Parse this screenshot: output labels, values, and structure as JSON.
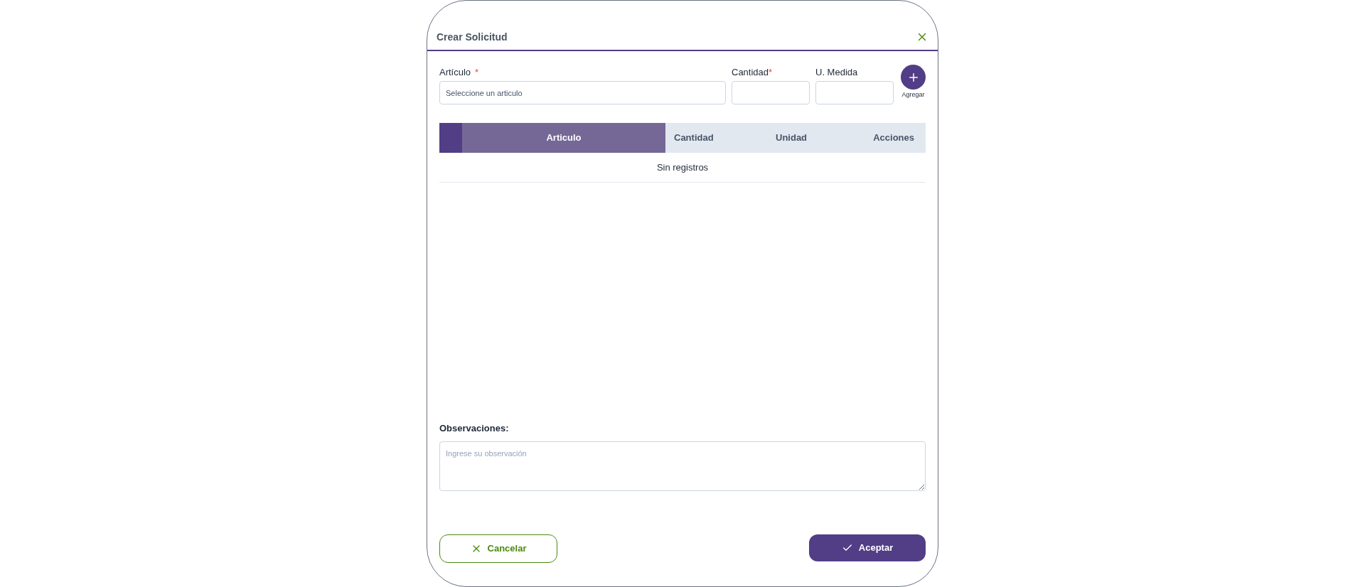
{
  "dialog": {
    "title": "Crear Solicitud"
  },
  "fields": [
    {
      "kind": "select",
      "label": "Artículo",
      "required_mark": "*",
      "placeholder": "Seleccione un articulo"
    },
    {
      "kind": "input",
      "label": "Cantidad",
      "required_mark": "*"
    },
    {
      "kind": "input",
      "label": "U. Medida"
    }
  ],
  "add_button": {
    "label": "Agregar"
  },
  "table": {
    "columns": [
      {
        "label": "Articulo",
        "sorted": true
      },
      {
        "label": "Cantidad",
        "sorted": false
      },
      {
        "label": "Unidad",
        "sorted": false
      },
      {
        "label": "Acciones",
        "sorted": false
      }
    ],
    "empty_message": "Sin registros"
  },
  "observations": {
    "label": "Observaciones:",
    "placeholder": "Ingrese su observación"
  },
  "buttons": [
    {
      "kind": "cancel",
      "label": "Cancelar"
    },
    {
      "kind": "accept",
      "label": "Aceptar"
    }
  ]
}
